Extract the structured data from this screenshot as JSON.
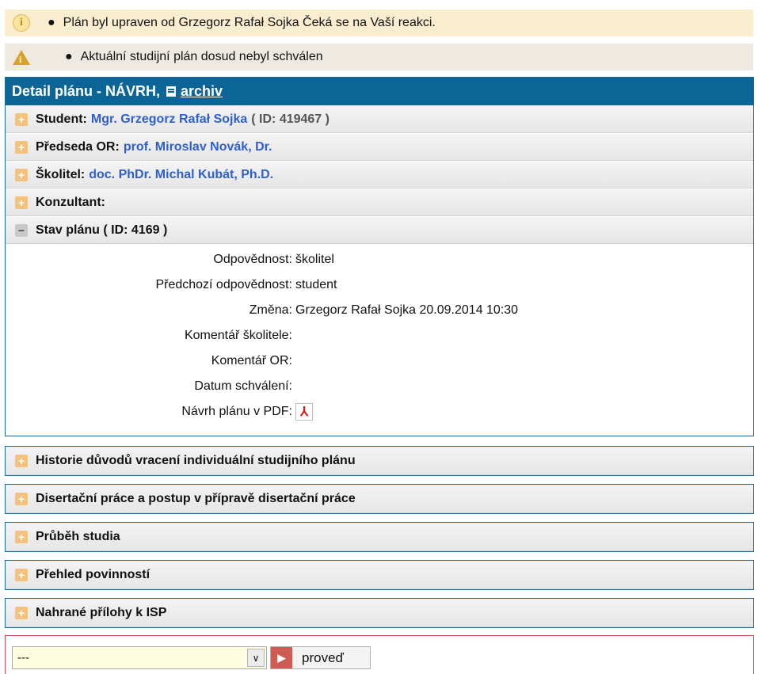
{
  "notices": [
    {
      "icon": "info-circle-icon",
      "text": "Plán byl upraven od Grzegorz Rafał Sojka Čeká se na Vaší reakci."
    },
    {
      "icon": "info-triangle-icon",
      "text": "Aktuální studijní plán dosud nebyl schválen"
    }
  ],
  "panel": {
    "title": "Detail plánu - NÁVRH,",
    "archive_link": "archiv",
    "rows": {
      "student": {
        "label": "Student:",
        "name": "Mgr. Grzegorz Rafał Sojka",
        "id": "( ID: 419467 )"
      },
      "chair": {
        "label": "Předseda OR:",
        "name": "prof. Miroslav Novák, Dr."
      },
      "supervisor": {
        "label": "Školitel:",
        "name": "doc. PhDr. Michal Kubát, Ph.D."
      },
      "consultant": {
        "label": "Konzultant:"
      },
      "state": {
        "label": "Stav plánu ( ID: 4169 )"
      }
    },
    "details": [
      {
        "label": "Odpovědnost:",
        "value": "školitel"
      },
      {
        "label": "Předchozí odpovědnost:",
        "value": "student"
      },
      {
        "label": "Změna:",
        "value": "Grzegorz Rafał Sojka 20.09.2014 10:30"
      },
      {
        "label": "Komentář školitele:",
        "value": ""
      },
      {
        "label": "Komentář OR:",
        "value": ""
      },
      {
        "label": "Datum schválení:",
        "value": ""
      },
      {
        "label": "Návrh plánu v PDF:",
        "value": ""
      }
    ]
  },
  "sections": [
    "Historie důvodů vracení individuální studijního plánu",
    "Disertační práce a postup v přípravě disertační práce",
    "Průběh studia",
    "Přehled povinností",
    "Nahrané přílohy k ISP"
  ],
  "action": {
    "select_value": "---",
    "button_label": "proveď"
  }
}
